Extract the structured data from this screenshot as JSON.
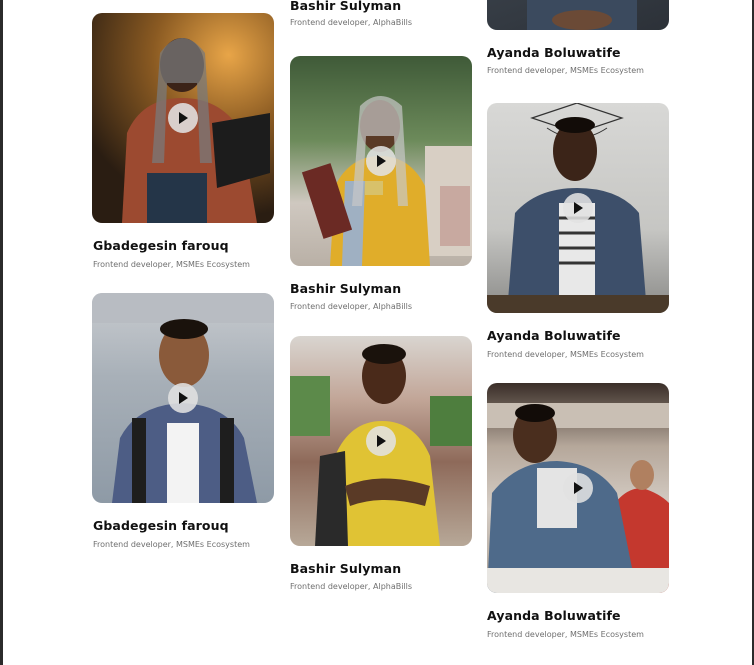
{
  "cards": [
    {
      "id": "c1",
      "name": "Gbadegesin farouq",
      "role": "Frontend developer, MSMEs Ecosystem"
    },
    {
      "id": "c2",
      "name": "Gbadegesin farouq",
      "role": "Frontend developer, MSMEs Ecosystem"
    },
    {
      "id": "c3",
      "name": "Bashir Sulyman",
      "role": "Frontend developer, AlphaBills"
    },
    {
      "id": "c4",
      "name": "Bashir Sulyman",
      "role": "Frontend developer, AlphaBills"
    },
    {
      "id": "c5",
      "name": "Bashir Sulyman",
      "role": "Frontend developer, AlphaBills"
    },
    {
      "id": "c6",
      "name": "Ayanda Boluwatife",
      "role": "Frontend developer, MSMEs Ecosystem"
    },
    {
      "id": "c7",
      "name": "Ayanda Boluwatife",
      "role": "Frontend developer, MSMEs Ecosystem"
    },
    {
      "id": "c8",
      "name": "Ayanda Boluwatife",
      "role": "Frontend developer, MSMEs Ecosystem"
    }
  ],
  "icons": {
    "play": "play-icon"
  }
}
